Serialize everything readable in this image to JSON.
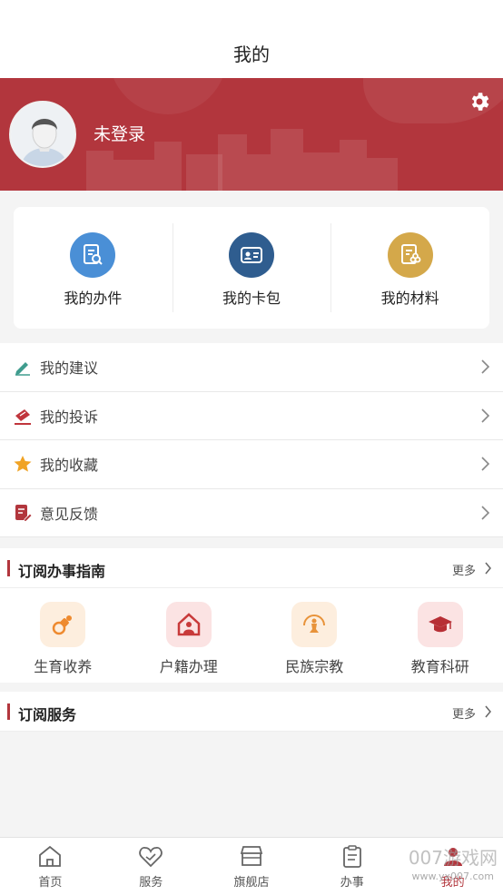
{
  "header": {
    "title": "我的"
  },
  "profile": {
    "login_status": "未登录"
  },
  "quick_actions": [
    {
      "label": "我的办件",
      "color": "#4a8fd6"
    },
    {
      "label": "我的卡包",
      "color": "#2f5d8f"
    },
    {
      "label": "我的材料",
      "color": "#d4a84a"
    }
  ],
  "menu": [
    {
      "label": "我的建议",
      "icon": "pen-edit-icon"
    },
    {
      "label": "我的投诉",
      "icon": "complaint-icon"
    },
    {
      "label": "我的收藏",
      "icon": "star-icon"
    },
    {
      "label": "意见反馈",
      "icon": "feedback-doc-icon"
    }
  ],
  "guide_section": {
    "title": "订阅办事指南",
    "more": "更多",
    "items": [
      {
        "label": "生育收养",
        "icon": "pacifier-icon"
      },
      {
        "label": "户籍办理",
        "icon": "house-person-icon"
      },
      {
        "label": "民族宗教",
        "icon": "praying-figure-icon"
      },
      {
        "label": "教育科研",
        "icon": "graduation-cap-icon"
      }
    ]
  },
  "service_section": {
    "title": "订阅服务",
    "more": "更多"
  },
  "tabbar": [
    {
      "label": "首页",
      "icon": "home-icon"
    },
    {
      "label": "服务",
      "icon": "heart-hand-icon"
    },
    {
      "label": "旗舰店",
      "icon": "store-icon"
    },
    {
      "label": "办事",
      "icon": "clipboard-icon"
    },
    {
      "label": "我的",
      "icon": "user-icon"
    }
  ],
  "watermark": {
    "text": "007游戏网",
    "url_text": "www.yx007.com"
  },
  "colors": {
    "brand_red": "#b2363d",
    "page_bg": "#f4f4f4"
  }
}
